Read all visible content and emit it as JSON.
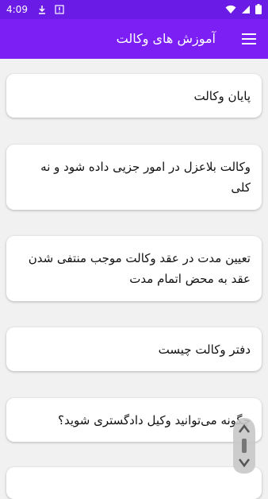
{
  "status_bar": {
    "time": "4:09",
    "icons": [
      "download-icon",
      "warning-icon",
      "wifi-icon",
      "signal-icon",
      "battery-icon"
    ]
  },
  "app_bar": {
    "title": "آموزش های وکالت",
    "menu_icon": "hamburger-menu-icon",
    "background": "#7c1ff5"
  },
  "items": [
    {
      "label": "پایان وکالت"
    },
    {
      "label": "وکالت بلاعزل در امور جزیی داده شود و نه کلی"
    },
    {
      "label": "تعیین مدت در عقد وکالت موجب منتفی شدن عقد به محض اتمام مدت"
    },
    {
      "label": "دفتر وکالت چیست"
    },
    {
      "label": "چگونه می‌توانید وکیل دادگستری شوید؟"
    },
    {
      "label": ""
    }
  ]
}
